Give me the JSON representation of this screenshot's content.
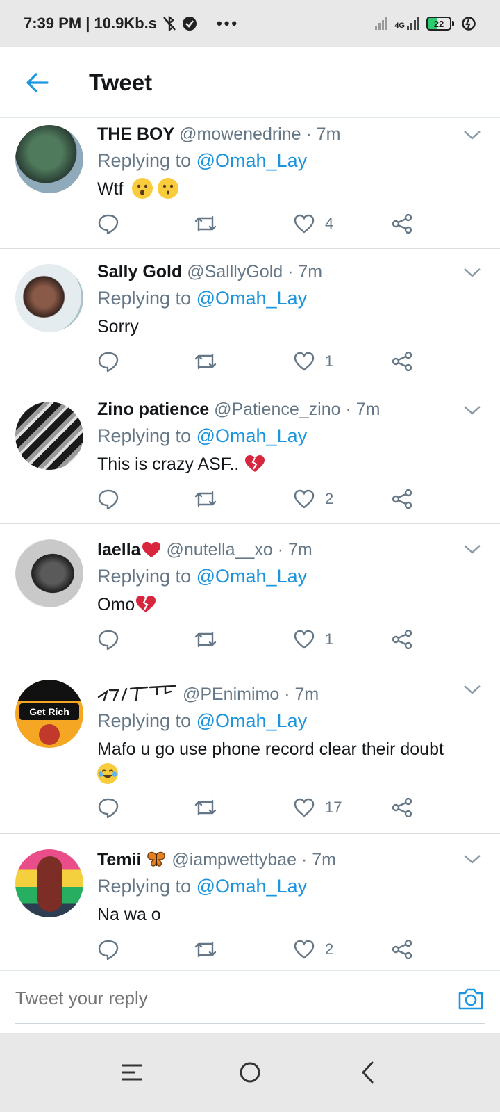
{
  "status_bar": {
    "time_text": "7:39 PM | 10.9Kb.s",
    "network_label": "4G",
    "battery_level": "22"
  },
  "header": {
    "title": "Tweet"
  },
  "tweets": [
    {
      "name": "THE BOY",
      "handle": "@mowenedrine",
      "time": "· 7m",
      "replying_prefix": "Replying to",
      "mention": "@Omah_Lay",
      "text": "Wtf",
      "likes": "4",
      "avatar_colors": [
        "#2e4a3a",
        "#6f8f7a"
      ]
    },
    {
      "name": "Sally Gold",
      "handle": "@SalllyGold",
      "time": "· 7m",
      "replying_prefix": "Replying to",
      "mention": "@Omah_Lay",
      "text": "Sorry",
      "likes": "1",
      "avatar_colors": [
        "#3a2a25",
        "#b89a8a"
      ]
    },
    {
      "name": "Zino patience",
      "handle": "@Patience_zino",
      "time": "· 7m",
      "replying_prefix": "Replying to",
      "mention": "@Omah_Lay",
      "text": "This is crazy ASF..",
      "likes": "2",
      "avatar_colors": [
        "#1c1c1c",
        "#8a8a8a"
      ]
    },
    {
      "name": "laella",
      "handle": "@nutella__xo",
      "time": "· 7m",
      "replying_prefix": "Replying to",
      "mention": "@Omah_Lay",
      "text": "Omo",
      "likes": "1",
      "avatar_colors": [
        "#3b3b3b",
        "#cfcfcf"
      ]
    },
    {
      "name": "",
      "handle": "@PEnimimo",
      "time": "· 7m",
      "replying_prefix": "Replying to",
      "mention": "@Omah_Lay",
      "text": "Mafo u go use phone record clear their doubt",
      "likes": "17",
      "avatar_colors": [
        "#f5a623",
        "#111111"
      ],
      "avatar_text": "Get Rich"
    },
    {
      "name": "Temii",
      "handle": "@iampwettybae",
      "time": "· 7m",
      "replying_prefix": "Replying to",
      "mention": "@Omah_Lay",
      "text": "Na wa o",
      "likes": "2",
      "avatar_colors": [
        "#c0392b",
        "#27ae60"
      ]
    }
  ],
  "reply_bar": {
    "placeholder": "Tweet your reply"
  },
  "colors": {
    "accent": "#1b95e0",
    "muted": "#657786",
    "divider": "#d9dee3"
  }
}
